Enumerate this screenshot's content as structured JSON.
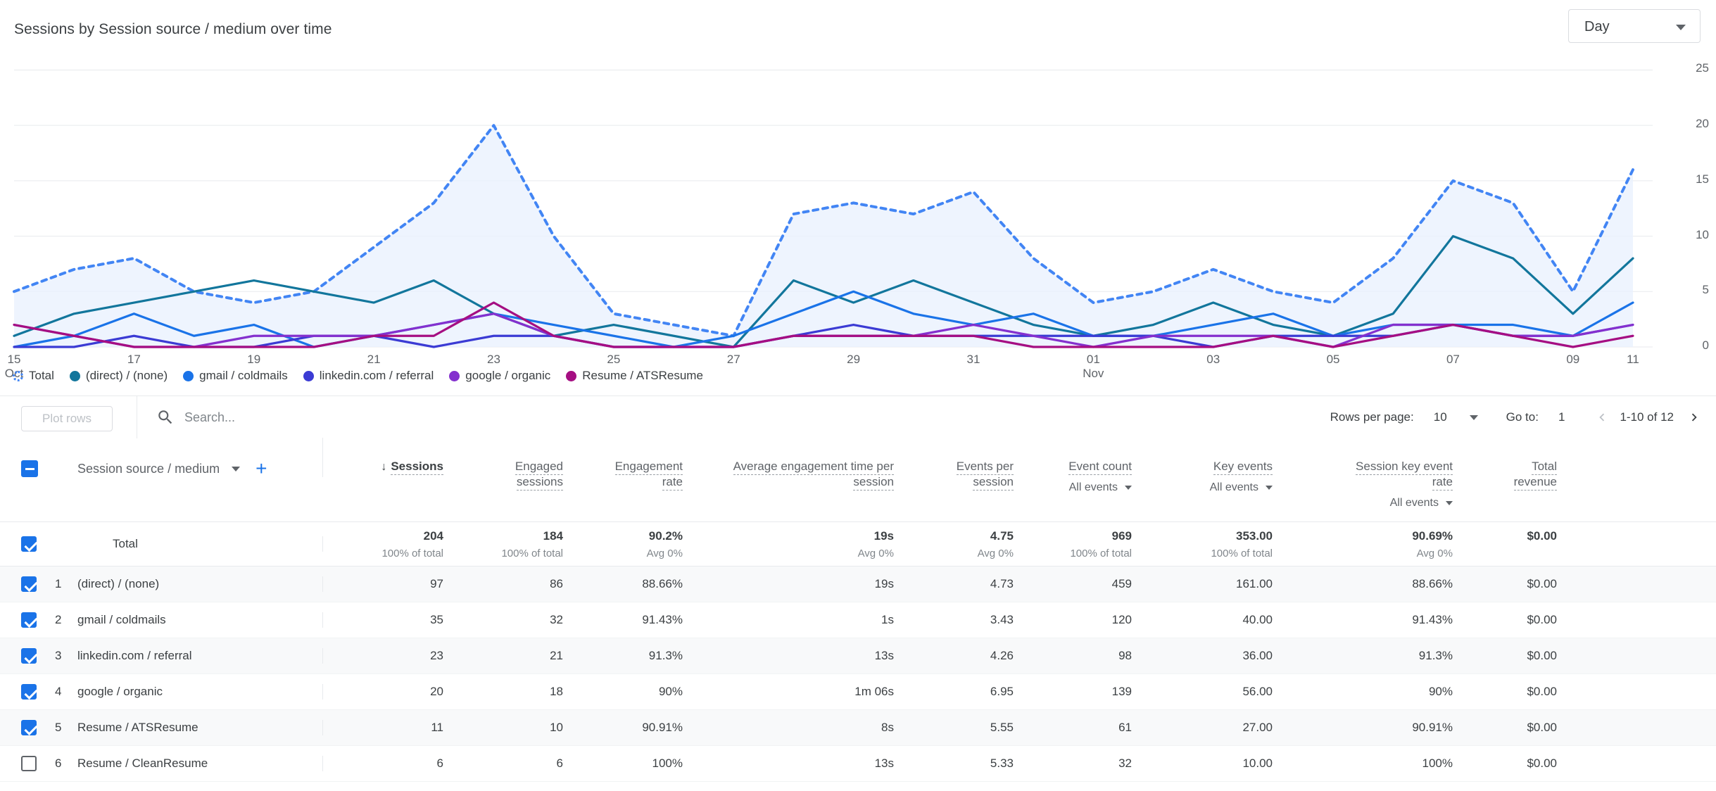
{
  "header": {
    "title": "Sessions by Session source / medium over time",
    "granularity_value": "Day",
    "granularity_icon": "chevron-down-icon"
  },
  "toolbar": {
    "plot_rows_label": "Plot rows",
    "search_placeholder": "Search...",
    "search_value": "",
    "search_icon": "search-icon",
    "rows_per_page_label": "Rows per page:",
    "rows_per_page_value": "10",
    "goto_label": "Go to:",
    "goto_value": "1",
    "range_label": "1-10 of 12",
    "prev_icon": "chevron-left-icon",
    "next_icon": "chevron-right-icon"
  },
  "table": {
    "dimension_label": "Session source / medium",
    "dimension_caret_icon": "chevron-down-icon",
    "add_dimension_icon": "plus-icon",
    "select_all_state": "indeterminate",
    "headers": [
      {
        "line1": "Sessions",
        "line2": "",
        "sub": "",
        "sorted": true,
        "sort_icon": "arrow-down-icon"
      },
      {
        "line1": "Engaged",
        "line2": "sessions",
        "sub": "",
        "sorted": false
      },
      {
        "line1": "Engagement",
        "line2": "rate",
        "sub": "",
        "sorted": false
      },
      {
        "line1": "Average engagement time per",
        "line2": "session",
        "sub": "",
        "sorted": false
      },
      {
        "line1": "Events per",
        "line2": "session",
        "sub": "",
        "sorted": false
      },
      {
        "line1": "Event count",
        "line2": "",
        "sub": "All events",
        "sorted": false
      },
      {
        "line1": "Key events",
        "line2": "",
        "sub": "All events",
        "sorted": false
      },
      {
        "line1": "Session key event",
        "line2": "rate",
        "sub": "All events",
        "sorted": false
      },
      {
        "line1": "Total",
        "line2": "revenue",
        "sub": "",
        "sorted": false
      }
    ],
    "total_row": {
      "label": "Total",
      "checked": true,
      "values": [
        "204",
        "184",
        "90.2%",
        "19s",
        "4.75",
        "969",
        "353.00",
        "90.69%",
        "$0.00"
      ],
      "subs": [
        "100% of total",
        "100% of total",
        "Avg 0%",
        "Avg 0%",
        "Avg 0%",
        "100% of total",
        "100% of total",
        "Avg 0%",
        ""
      ]
    },
    "rows": [
      {
        "index": "1",
        "name": "(direct) / (none)",
        "checked": true,
        "values": [
          "97",
          "86",
          "88.66%",
          "19s",
          "4.73",
          "459",
          "161.00",
          "88.66%",
          "$0.00"
        ]
      },
      {
        "index": "2",
        "name": "gmail / coldmails",
        "checked": true,
        "values": [
          "35",
          "32",
          "91.43%",
          "1s",
          "3.43",
          "120",
          "40.00",
          "91.43%",
          "$0.00"
        ]
      },
      {
        "index": "3",
        "name": "linkedin.com / referral",
        "checked": true,
        "values": [
          "23",
          "21",
          "91.3%",
          "13s",
          "4.26",
          "98",
          "36.00",
          "91.3%",
          "$0.00"
        ]
      },
      {
        "index": "4",
        "name": "google / organic",
        "checked": true,
        "values": [
          "20",
          "18",
          "90%",
          "1m 06s",
          "6.95",
          "139",
          "56.00",
          "90%",
          "$0.00"
        ]
      },
      {
        "index": "5",
        "name": "Resume / ATSResume",
        "checked": true,
        "values": [
          "11",
          "10",
          "90.91%",
          "8s",
          "5.55",
          "61",
          "27.00",
          "90.91%",
          "$0.00"
        ]
      },
      {
        "index": "6",
        "name": "Resume / CleanResume",
        "checked": false,
        "values": [
          "6",
          "6",
          "100%",
          "13s",
          "5.33",
          "32",
          "10.00",
          "100%",
          "$0.00"
        ]
      }
    ]
  },
  "chart_data": {
    "type": "line",
    "title": "Sessions by Session source / medium over time",
    "xlabel": "",
    "ylabel": "",
    "ylim": [
      0,
      27
    ],
    "yticks": [
      0,
      5,
      10,
      15,
      20,
      25
    ],
    "grid": true,
    "legend_position": "bottom",
    "x": [
      "Oct 15",
      "Oct 16",
      "Oct 17",
      "Oct 18",
      "Oct 19",
      "Oct 20",
      "Oct 21",
      "Oct 22",
      "Oct 23",
      "Oct 24",
      "Oct 25",
      "Oct 26",
      "Oct 27",
      "Oct 28",
      "Oct 29",
      "Oct 30",
      "Oct 31",
      "Nov 01",
      "Nov 02",
      "Nov 03",
      "Nov 04",
      "Nov 05",
      "Nov 06",
      "Nov 07",
      "Nov 08",
      "Nov 09",
      "Nov 10",
      "Nov 11"
    ],
    "xtick_labels": [
      "15",
      "17",
      "19",
      "21",
      "23",
      "25",
      "27",
      "29",
      "31",
      "01",
      "03",
      "05",
      "07",
      "09",
      "11"
    ],
    "xtick_months": [
      "Oct",
      "",
      "",
      "",
      "",
      "",
      "",
      "",
      "",
      "Nov",
      "",
      "",
      "",
      "",
      ""
    ],
    "series": [
      {
        "name": "Total",
        "color": "#4285f4",
        "style": "dotted",
        "filled": true,
        "values": [
          5,
          7,
          8,
          5,
          4,
          5,
          9,
          13,
          20,
          10,
          3,
          2,
          1,
          12,
          13,
          12,
          14,
          8,
          4,
          5,
          7,
          5,
          4,
          8,
          15,
          13,
          5,
          16
        ]
      },
      {
        "name": "(direct) / (none)",
        "color": "#12769c",
        "style": "solid",
        "filled": false,
        "values": [
          1,
          3,
          4,
          5,
          6,
          5,
          4,
          6,
          3,
          1,
          2,
          1,
          0,
          6,
          4,
          6,
          4,
          2,
          1,
          2,
          4,
          2,
          1,
          3,
          10,
          8,
          3,
          8
        ]
      },
      {
        "name": "gmail / coldmails",
        "color": "#1a73e8",
        "style": "solid",
        "filled": false,
        "values": [
          0,
          1,
          3,
          1,
          2,
          0,
          1,
          2,
          3,
          2,
          1,
          0,
          1,
          3,
          5,
          3,
          2,
          3,
          1,
          1,
          2,
          3,
          1,
          2,
          2,
          2,
          1,
          4
        ]
      },
      {
        "name": "linkedin.com / referral",
        "color": "#3b3bd4",
        "style": "solid",
        "filled": false,
        "values": [
          0,
          0,
          1,
          0,
          0,
          1,
          1,
          0,
          1,
          1,
          0,
          0,
          0,
          1,
          2,
          1,
          1,
          1,
          1,
          1,
          0,
          1,
          1,
          1,
          2,
          1,
          1,
          2
        ]
      },
      {
        "name": "google / organic",
        "color": "#8430ce",
        "style": "solid",
        "filled": false,
        "values": [
          2,
          1,
          0,
          0,
          1,
          1,
          1,
          2,
          3,
          1,
          0,
          0,
          0,
          1,
          1,
          1,
          2,
          1,
          0,
          1,
          1,
          1,
          0,
          2,
          2,
          1,
          1,
          2
        ]
      },
      {
        "name": "Resume / ATSResume",
        "color": "#a50e82",
        "style": "solid",
        "filled": false,
        "values": [
          2,
          1,
          0,
          0,
          0,
          0,
          1,
          1,
          4,
          1,
          0,
          0,
          0,
          1,
          1,
          1,
          1,
          0,
          0,
          0,
          0,
          1,
          0,
          1,
          2,
          1,
          0,
          1
        ]
      }
    ]
  }
}
